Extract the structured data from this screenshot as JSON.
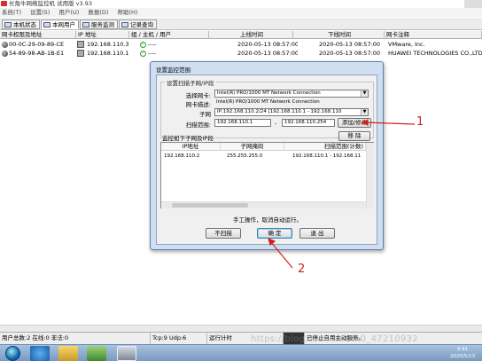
{
  "app": {
    "title": "长角牛网络监控机 试用版 v3.93"
  },
  "menu": [
    "系统(T)",
    "设置(S)",
    "用户(U)",
    "数据(D)",
    "帮助(H)"
  ],
  "tabs": [
    {
      "label": "本机状态"
    },
    {
      "label": "本网用户"
    },
    {
      "label": "服务监测"
    },
    {
      "label": "记录查询"
    }
  ],
  "columns": [
    "网卡权限及地址",
    "IP 地址",
    "组 / 主机 / 用户",
    "上线时间",
    "下线时间",
    "网卡注释"
  ],
  "rows": [
    {
      "mac": "00-0C-29-09-89-CE",
      "ip": "192.168.110.3",
      "host": "----",
      "online": "2020-05-13 08:57:00",
      "offline": "2020-05-13 08:57:00",
      "vendor": "VMware, Inc."
    },
    {
      "mac": "54-89-98-AB-1B-E1",
      "ip": "192.168.110.1",
      "host": "----",
      "online": "2020-05-13 08:57:00",
      "offline": "2020-05-13 08:57:00",
      "vendor": "HUAWEI TECHNOLOGIES CO.,LTD"
    }
  ],
  "dialog": {
    "title": "设置监控范围",
    "group_scan": "设置扫描子网/IP段",
    "nic_label": "选择网卡:",
    "nic_value": "Intel(R) PRO/1000 MT Network Connection",
    "desc_label": "网卡描述:",
    "desc_value": "Intel(R) PRO/1000 MT Network Connection",
    "subnet_label": "子网",
    "subnet_value": "IP:192.168.110.2/24 [192.168.110.1 - 192.168.110",
    "range_label": "扫描范围:",
    "range_from": "192.168.110.1",
    "range_sep": "-",
    "range_to": "192.168.110.254",
    "add_button": "添加/修改",
    "remove_button": "移 除",
    "group_monitor": "监控如下子网及IP段",
    "list_headers": [
      "IP地址",
      "子网掩码",
      "扫描范围(计数)"
    ],
    "list_rows": [
      {
        "ip": "192.168.110.2",
        "mask": "255.255.255.0",
        "range": "192.168.110.1 - 192.168.11"
      }
    ],
    "hint": "手工操作，取消自动运行。",
    "buttons": {
      "noscan": "不扫描",
      "ok": "确 定",
      "cancel": "退 出"
    }
  },
  "status": {
    "users": "用户总数:2 在线:0 非法:0",
    "ports": "Tcp:9 Udp:6",
    "uptime": "运行计时",
    "note": "已停止自用主动服务。"
  },
  "taskbar": {
    "time": "9:41",
    "date": "2020/5/13"
  },
  "watermark": "https://blog.csdn.net/m0_47210932",
  "annotations": {
    "one": "1",
    "two": "2"
  },
  "colors": {
    "accent": "#3c7fb1",
    "annotation": "#d12020",
    "dialog_frame": "#cfdff1"
  }
}
